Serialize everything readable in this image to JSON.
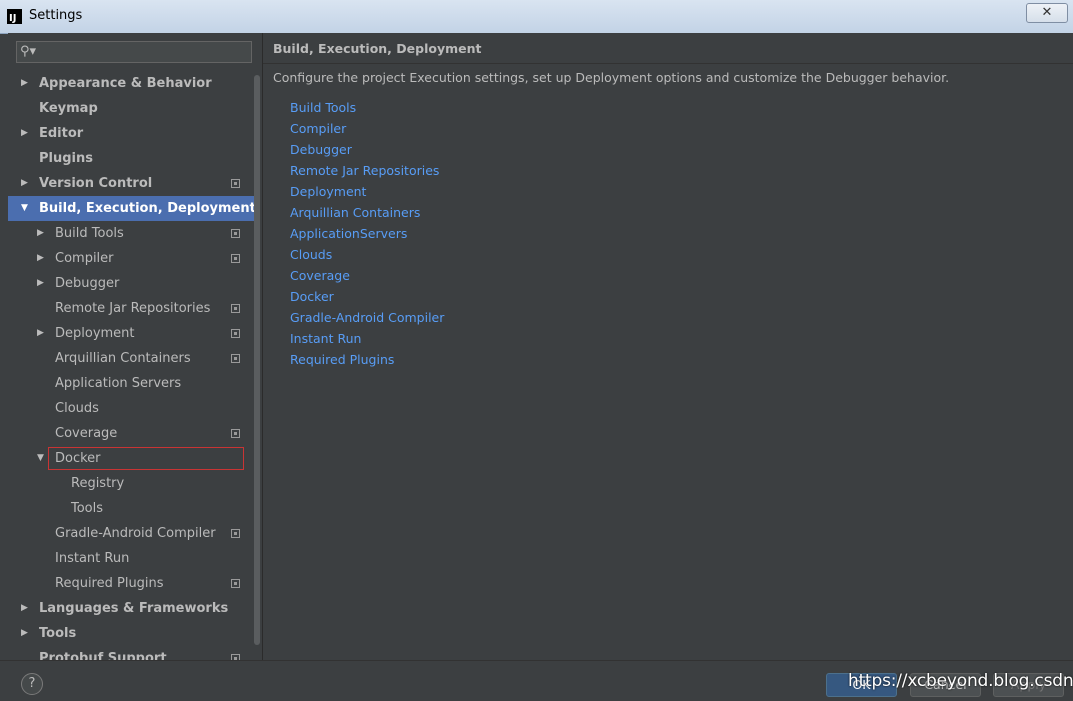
{
  "window": {
    "title": "Settings",
    "app_icon": "IJ",
    "close": "✕"
  },
  "search": {
    "icon": "⚲▾",
    "value": ""
  },
  "tree": [
    {
      "label": "Appearance & Behavior",
      "level": 0,
      "bold": true,
      "arrow": "right",
      "project": false
    },
    {
      "label": "Keymap",
      "level": 0,
      "bold": true,
      "arrow": "",
      "project": false
    },
    {
      "label": "Editor",
      "level": 0,
      "bold": true,
      "arrow": "right",
      "project": false
    },
    {
      "label": "Plugins",
      "level": 0,
      "bold": true,
      "arrow": "",
      "project": false
    },
    {
      "label": "Version Control",
      "level": 0,
      "bold": true,
      "arrow": "right",
      "project": true
    },
    {
      "label": "Build, Execution, Deployment",
      "level": 0,
      "bold": true,
      "arrow": "down",
      "project": false,
      "selected": true
    },
    {
      "label": "Build Tools",
      "level": 1,
      "bold": false,
      "arrow": "right",
      "project": true
    },
    {
      "label": "Compiler",
      "level": 1,
      "bold": false,
      "arrow": "right",
      "project": true
    },
    {
      "label": "Debugger",
      "level": 1,
      "bold": false,
      "arrow": "right",
      "project": false
    },
    {
      "label": "Remote Jar Repositories",
      "level": 1,
      "bold": false,
      "arrow": "",
      "project": true
    },
    {
      "label": "Deployment",
      "level": 1,
      "bold": false,
      "arrow": "right",
      "project": true
    },
    {
      "label": "Arquillian Containers",
      "level": 1,
      "bold": false,
      "arrow": "",
      "project": true
    },
    {
      "label": "Application Servers",
      "level": 1,
      "bold": false,
      "arrow": "",
      "project": false
    },
    {
      "label": "Clouds",
      "level": 1,
      "bold": false,
      "arrow": "",
      "project": false
    },
    {
      "label": "Coverage",
      "level": 1,
      "bold": false,
      "arrow": "",
      "project": true
    },
    {
      "label": "Docker",
      "level": 1,
      "bold": false,
      "arrow": "down",
      "project": false,
      "outlined": true
    },
    {
      "label": "Registry",
      "level": 2,
      "bold": false,
      "arrow": "",
      "project": false
    },
    {
      "label": "Tools",
      "level": 2,
      "bold": false,
      "arrow": "",
      "project": false
    },
    {
      "label": "Gradle-Android Compiler",
      "level": 1,
      "bold": false,
      "arrow": "",
      "project": true
    },
    {
      "label": "Instant Run",
      "level": 1,
      "bold": false,
      "arrow": "",
      "project": false
    },
    {
      "label": "Required Plugins",
      "level": 1,
      "bold": false,
      "arrow": "",
      "project": true
    },
    {
      "label": "Languages & Frameworks",
      "level": 0,
      "bold": true,
      "arrow": "right",
      "project": false
    },
    {
      "label": "Tools",
      "level": 0,
      "bold": true,
      "arrow": "right",
      "project": false
    },
    {
      "label": "Protobuf Support",
      "level": 0,
      "bold": true,
      "arrow": "",
      "project": true
    }
  ],
  "main": {
    "title": "Build, Execution, Deployment",
    "description": "Configure the project Execution settings, set up Deployment options and customize the Debugger behavior.",
    "links": [
      "Build Tools",
      "Compiler",
      "Debugger",
      "Remote Jar Repositories",
      "Deployment",
      "Arquillian Containers",
      "ApplicationServers",
      "Clouds",
      "Coverage",
      "Docker",
      "Gradle-Android Compiler",
      "Instant Run",
      "Required Plugins"
    ]
  },
  "footer": {
    "help": "?",
    "ok": "OK",
    "cancel": "Cancel",
    "apply": "Apply"
  },
  "watermark": "https://xcbeyond.blog.csdn.net",
  "colors": {
    "selection": "#4b6eaf",
    "link": "#589df6",
    "outline": "#c93434",
    "background": "#3c3f41"
  }
}
